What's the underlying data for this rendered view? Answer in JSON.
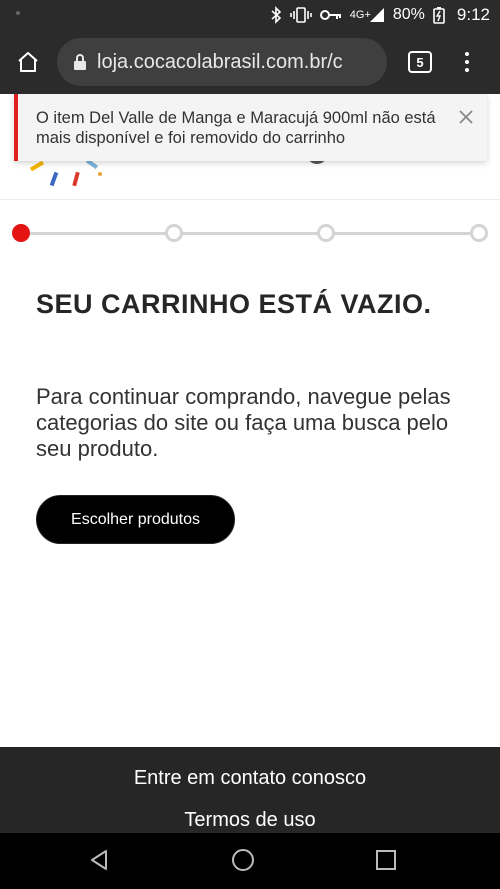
{
  "status_bar": {
    "network": "4G+",
    "battery": "80%",
    "time": "9:12",
    "icons": [
      "bluetooth-icon",
      "vibrate-icon",
      "vpn-key-icon",
      "signal-icon",
      "battery-charging-icon"
    ]
  },
  "browser": {
    "url": "loja.cocacolabrasil.com.br/c",
    "tab_count": "5"
  },
  "toast": {
    "message": "O item Del Valle de Manga e Maracujá 900ml não está mais disponível e foi removido do carrinho"
  },
  "stepper": {
    "active_step": 1,
    "total_steps": 4,
    "active_color": "#e41414"
  },
  "cart": {
    "title": "SEU CARRINHO ESTÁ VAZIO.",
    "subtitle": "Para continuar comprando, navegue pelas categorias do site ou faça uma busca pelo seu produto.",
    "cta_label": "Escolher produtos"
  },
  "footer": {
    "links": [
      "Entre em contato conosco",
      "Termos de uso"
    ]
  }
}
